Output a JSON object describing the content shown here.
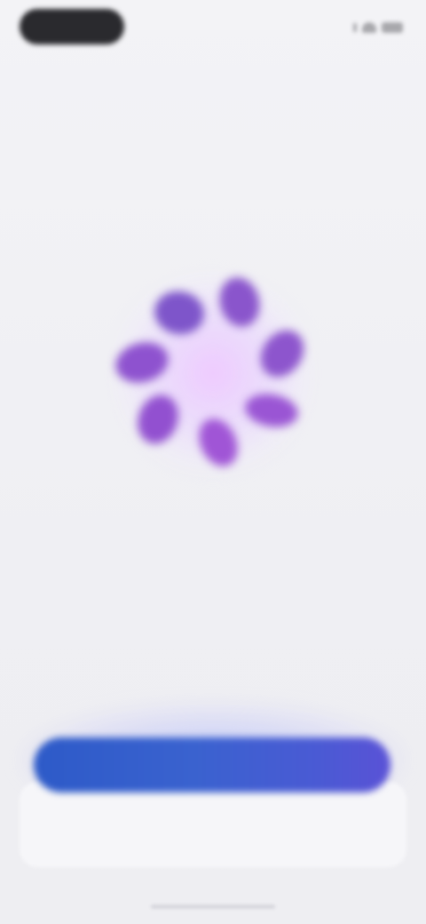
{
  "status_bar": {
    "time": "",
    "icons": [
      "signal-icon",
      "wifi-icon",
      "battery-icon"
    ]
  },
  "loader": {
    "icon": "spinner-icon",
    "accent_color": "#8a4fd0",
    "glow_color": "#e9c8ff"
  },
  "actions": {
    "primary_label": "",
    "primary_color": "#3a5fd0",
    "secondary_label": ""
  }
}
